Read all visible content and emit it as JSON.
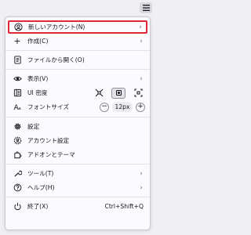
{
  "menu": {
    "new_account": "新しいアカウント(N)",
    "create": "作成(C)",
    "open_file": "ファイルから開く(O)",
    "view": "表示(V)",
    "ui_density": "UI 密度",
    "font_size": "フォントサイズ",
    "font_size_value": "12px",
    "settings": "設定",
    "account_settings": "アカウント設定",
    "addons": "アドオンとテーマ",
    "tools": "ツール(T)",
    "help": "ヘルプ(H)",
    "quit": "終了(X)",
    "quit_shortcut": "Ctrl+Shift+Q"
  },
  "glyphs": {
    "chevron": "›",
    "plus": "+",
    "minus": "−"
  },
  "colors": {
    "highlight_border": "#e0283a",
    "panel_bg": "#fbfbfe"
  }
}
